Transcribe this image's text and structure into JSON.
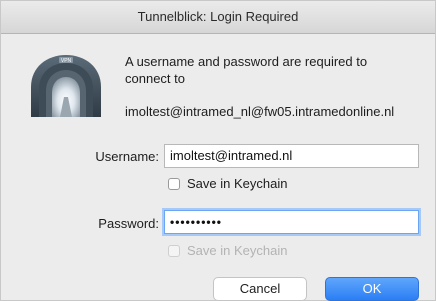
{
  "window": {
    "title": "Tunnelblick: Login Required"
  },
  "icon": {
    "name": "tunnelblick-vpn-icon",
    "badge": "VPN"
  },
  "message": {
    "text": "A username and password are required to connect to",
    "connection": "imoltest@intramed_nl@fw05.intramedonline.nl"
  },
  "form": {
    "username_label": "Username:",
    "username_value": "imoltest@intramed.nl",
    "save_username_label": "Save in Keychain",
    "save_username_checked": false,
    "password_label": "Password:",
    "password_display": "••••••••••",
    "save_password_label": "Save in Keychain",
    "save_password_checked": false,
    "save_password_enabled": false
  },
  "buttons": {
    "cancel_label": "Cancel",
    "ok_label": "OK"
  },
  "colors": {
    "accent": "#2b7ef5",
    "focus_ring": "#a6c9f8",
    "window_bg": "#ececec"
  }
}
